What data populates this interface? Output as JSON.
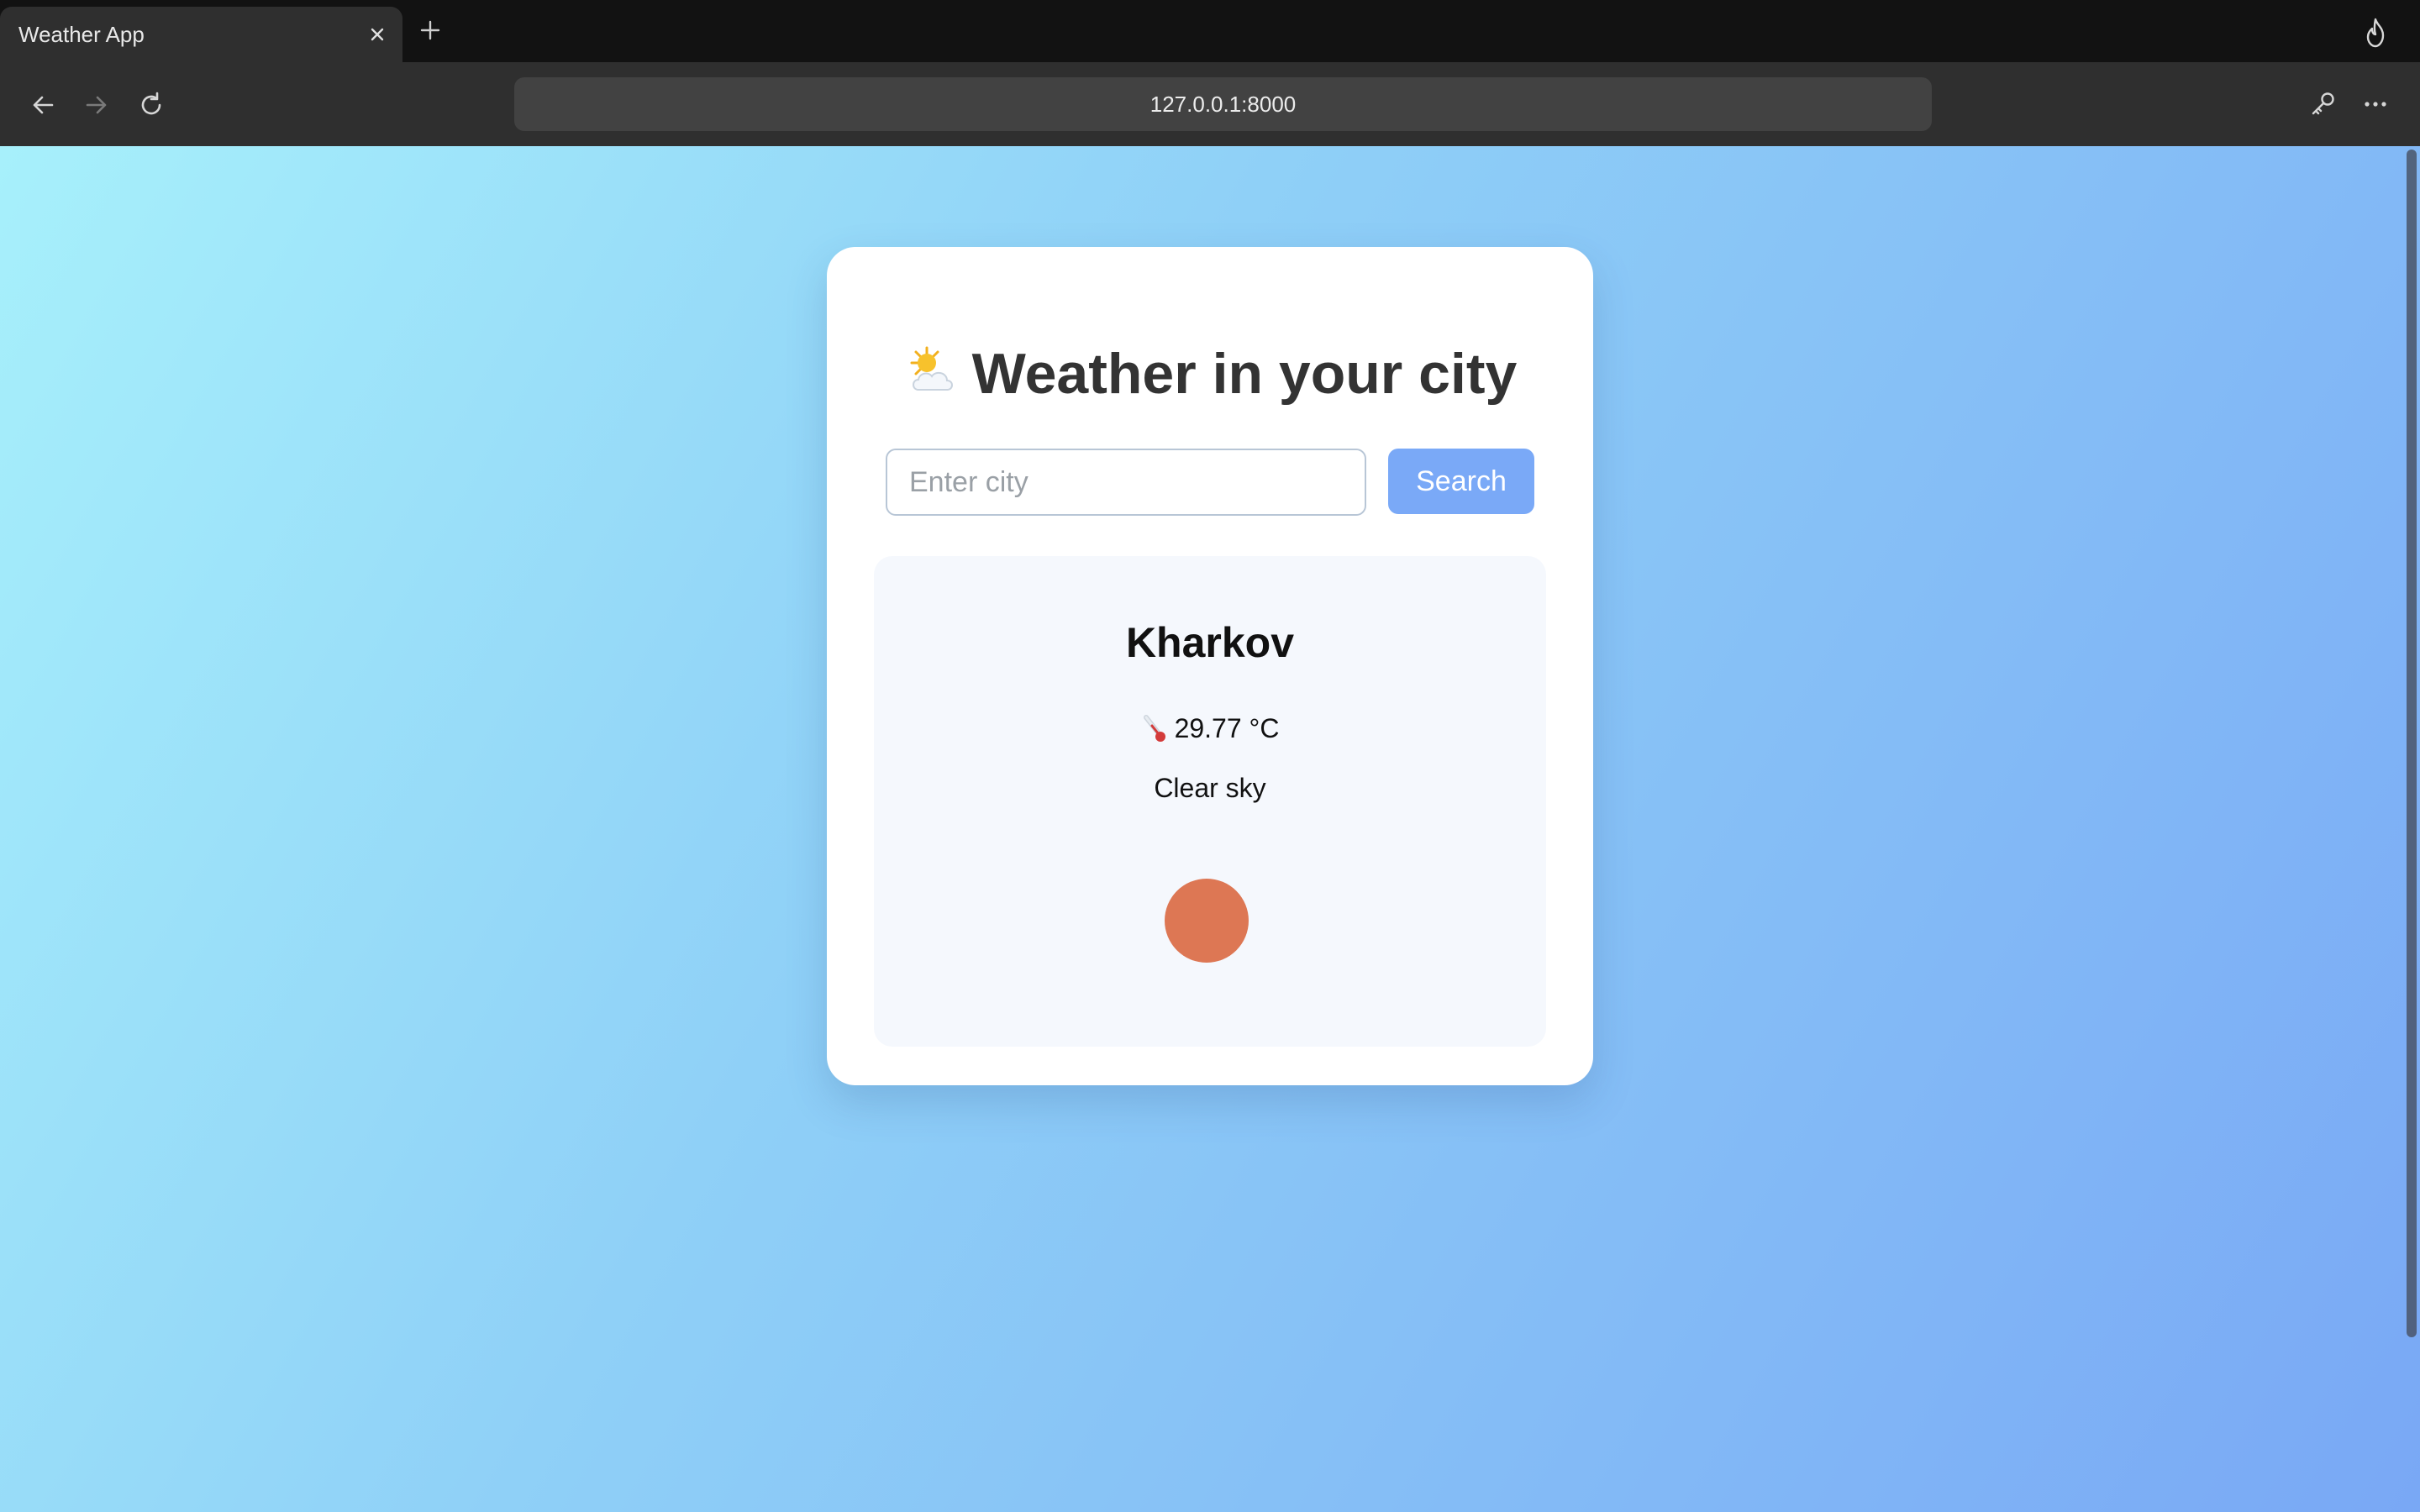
{
  "browser": {
    "tab_title": "Weather App",
    "url": "127.0.0.1:8000",
    "icons": [
      "close-icon",
      "plus-icon",
      "fire-icon",
      "back-icon",
      "forward-icon",
      "reload-icon",
      "key-icon",
      "more-icon"
    ]
  },
  "app": {
    "title": "Weather in your city",
    "title_icon": "sun-behind-cloud-icon",
    "search": {
      "placeholder": "Enter city",
      "value": "",
      "button_label": "Search"
    },
    "result": {
      "city": "Kharkov",
      "temperature": "29.77 °C",
      "description": "Clear sky",
      "weather_icon": "sun-icon",
      "weather_icon_color": "#dd7754"
    }
  },
  "colors": {
    "accent": "#7aa9f7",
    "gradient_start": "#a7f0fb",
    "gradient_end": "#79a8f5",
    "title_text": "#333333"
  }
}
